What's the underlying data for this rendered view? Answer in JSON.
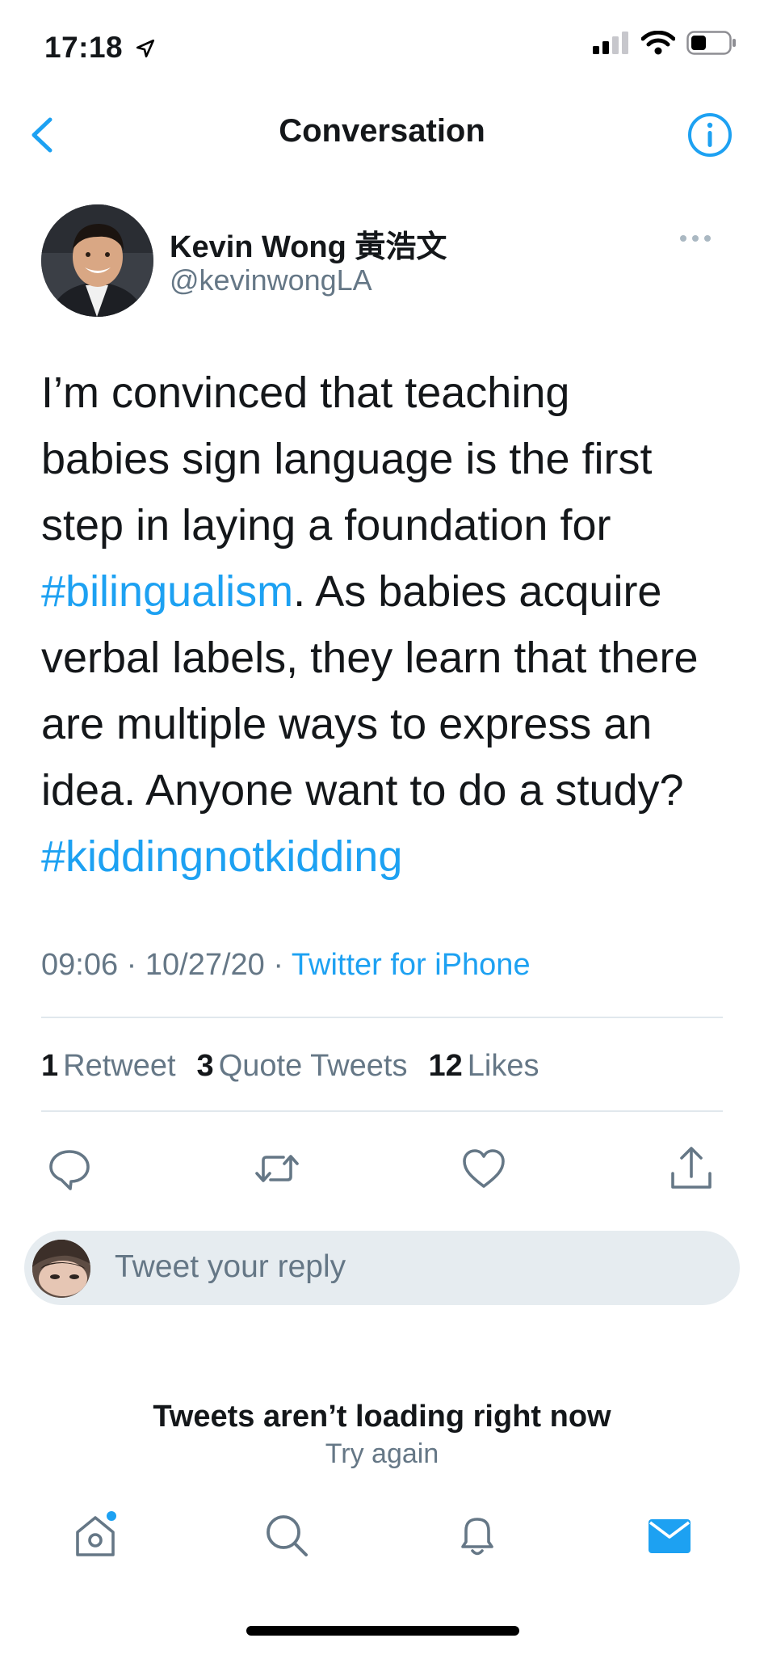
{
  "status_bar": {
    "time": "17:18"
  },
  "header": {
    "title": "Conversation"
  },
  "tweet": {
    "author_name": "Kevin Wong 黃浩文",
    "author_handle": "@kevinwongLA",
    "lines": [
      {
        "pre": "I’m convinced that teaching",
        "tag": "",
        "post": ""
      },
      {
        "pre": "babies sign language is the first",
        "tag": "",
        "post": ""
      },
      {
        "pre": "step in laying a foundation for",
        "tag": "",
        "post": ""
      },
      {
        "pre": "",
        "tag": "#bilingualism",
        "post": ". As babies acquire"
      },
      {
        "pre": "verbal labels, they learn that there",
        "tag": "",
        "post": ""
      },
      {
        "pre": "are multiple ways to express an",
        "tag": "",
        "post": ""
      },
      {
        "pre": "idea. Anyone want to do a study?",
        "tag": "",
        "post": ""
      },
      {
        "pre": "",
        "tag": "#kiddingnotkidding",
        "post": ""
      }
    ],
    "time": "09:06",
    "date": "10/27/20",
    "source": "Twitter for iPhone",
    "stats": {
      "retweets_count": "1",
      "retweets_label": "Retweet",
      "quotes_count": "3",
      "quotes_label": "Quote Tweets",
      "likes_count": "12",
      "likes_label": "Likes"
    }
  },
  "reply": {
    "placeholder": "Tweet your reply"
  },
  "error": {
    "title": "Tweets aren’t loading right now",
    "retry": "Try again"
  },
  "colors": {
    "accent": "#1da1f2",
    "secondary_text": "#657786",
    "divider": "#e1e8ed",
    "reply_bg": "#e6ecf0"
  },
  "icons": [
    "location-arrow-icon",
    "signal-icon",
    "wifi-icon",
    "battery-icon",
    "back-chevron-icon",
    "info-icon",
    "more-icon",
    "reply-icon",
    "retweet-icon",
    "like-icon",
    "share-icon",
    "home-icon",
    "search-icon",
    "bell-icon",
    "mail-icon"
  ]
}
